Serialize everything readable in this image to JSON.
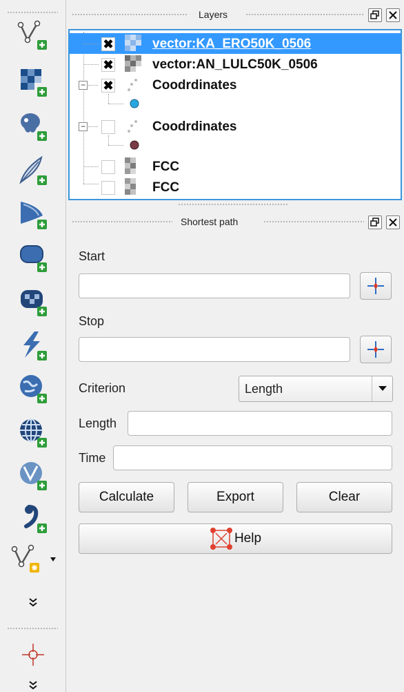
{
  "toolbar": {
    "icons": [
      "add-vector-layer-icon",
      "add-raster-layer-icon",
      "add-postgis-layer-icon",
      "add-spatialite-layer-icon",
      "add-mssql-layer-icon",
      "add-oracle-layer-icon",
      "add-db2-layer-icon",
      "add-virtual-layer-icon",
      "add-wms-layer-icon",
      "add-wcs-layer-icon",
      "add-wfs-layer-icon",
      "add-delimited-text-layer-icon",
      "new-shapefile-layer-icon",
      "expand-more-icon",
      "add-point-icon",
      "expand-more-icon"
    ]
  },
  "layers_dock": {
    "title": "Layers",
    "items": [
      {
        "name": "vector:KA_ERO50K_0506",
        "checked": true,
        "selected": true
      },
      {
        "name": "vector:AN_LULC50K_0506",
        "checked": true,
        "selected": false
      },
      {
        "name": "Coodrdinates",
        "checked": true,
        "selected": false,
        "expanded": true,
        "symbol_color": "#29a7e1"
      },
      {
        "name": "Coodrdinates",
        "checked": false,
        "selected": false,
        "expanded": true,
        "symbol_color": "#7a3a46"
      },
      {
        "name": "FCC",
        "checked": false,
        "selected": false
      },
      {
        "name": "FCC",
        "checked": false,
        "selected": false
      }
    ]
  },
  "shortest_path": {
    "title": "Shortest path",
    "start_label": "Start",
    "start_value": "",
    "stop_label": "Stop",
    "stop_value": "",
    "criterion_label": "Criterion",
    "criterion_value": "Length",
    "length_label": "Length",
    "length_value": "",
    "time_label": "Time",
    "time_value": "",
    "calculate_label": "Calculate",
    "export_label": "Export",
    "clear_label": "Clear",
    "help_label": "Help"
  },
  "colors": {
    "selection": "#3399ff",
    "accent_border": "#3a96dd"
  }
}
